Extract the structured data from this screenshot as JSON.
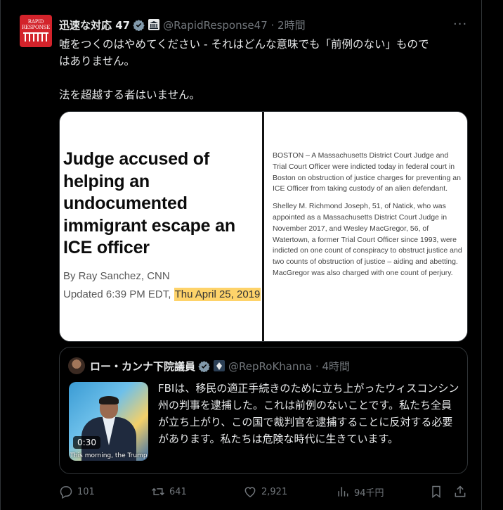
{
  "tweet": {
    "avatar_lines": [
      "RAPID",
      "RESPONSE"
    ],
    "display_name": "迅速な対応 47",
    "handle_time": "@RapidResponse47 · 2時間",
    "more_label": "···",
    "text_line1": "嘘をつくのはやめてください - それはどんな意味でも「前例のない」もので",
    "text_line2": "はありません。",
    "text_line3": "法を超越する者はいません。"
  },
  "media": {
    "headline_lines": [
      "Judge accused of",
      "helping an",
      "undocumented",
      "immigrant escape an",
      "ICE officer"
    ],
    "byline": "By Ray Sanchez, CNN",
    "updated_prefix": "Updated 6:39 PM EDT, ",
    "updated_date": "Thu April 25, 2019",
    "paragraph1": "BOSTON – A Massachusetts District Court Judge and Trial Court Officer were indicted today in federal court in Boston on obstruction of justice charges for preventing an ICE Officer from taking custody of an alien defendant.",
    "paragraph2": "Shelley M. Richmond Joseph, 51, of Natick, who was appointed as a Massachusetts District Court Judge in November 2017, and Wesley MacGregor, 56, of Watertown, a former Trial Court Officer since 1993, were indicted on one count of conspiracy to obstruct justice and two counts of obstruction of justice – aiding and abetting. MacGregor was also charged with one count of perjury."
  },
  "quote": {
    "display_name": "ロー・カンナ下院議員",
    "handle_time": "@RepRoKhanna · 4時間",
    "video_duration": "0:30",
    "video_caption": "This morning, the Trump",
    "text": "FBIは、移民の適正手続きのために立ち上がったウィスコンシン州の判事を逮捕した。これは前例のないことです。私たち全員が立ち上がり、この国で裁判官を逮捕することに反対する必要があります。私たちは危険な時代に生きています。"
  },
  "actions": {
    "replies": "101",
    "reposts": "641",
    "likes": "2,921",
    "views": "94千円"
  },
  "colors": {
    "background": "#000000",
    "text_primary": "#e7e9ea",
    "text_secondary": "#71767b",
    "border": "#2f3336",
    "verified": "#829aab",
    "avatar_brand": "#d3232b",
    "highlight": "#fed36a"
  },
  "icons": [
    "verified-badge-icon",
    "government-building-icon",
    "more-options-icon",
    "reply-icon",
    "repost-icon",
    "like-icon",
    "views-icon",
    "bookmark-icon",
    "share-icon"
  ]
}
